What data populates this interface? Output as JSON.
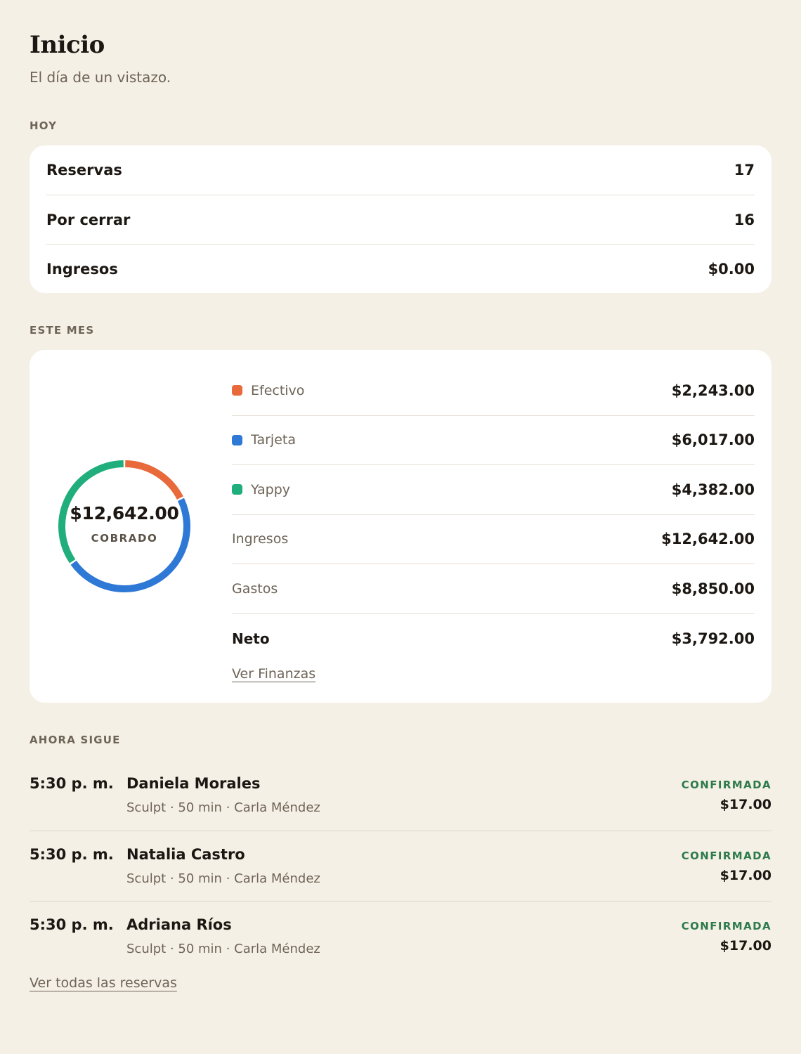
{
  "header": {
    "title": "Inicio",
    "subtitle": "El día de un vistazo."
  },
  "today": {
    "section_label": "HOY",
    "rows": [
      {
        "label": "Reservas",
        "value": "17"
      },
      {
        "label": "Por cerrar",
        "value": "16"
      },
      {
        "label": "Ingresos",
        "value": "$0.00"
      }
    ]
  },
  "month": {
    "section_label": "ESTE MES",
    "donut": {
      "total": "$12,642.00",
      "caption": "COBRADO"
    },
    "methods": [
      {
        "label": "Efectivo",
        "value": "$2,243.00",
        "color": "#e8693a"
      },
      {
        "label": "Tarjeta",
        "value": "$6,017.00",
        "color": "#2e78d6"
      },
      {
        "label": "Yappy",
        "value": "$4,382.00",
        "color": "#1fae7c"
      }
    ],
    "summary": [
      {
        "label": "Ingresos",
        "value": "$12,642.00"
      },
      {
        "label": "Gastos",
        "value": "$8,850.00"
      },
      {
        "label": "Neto",
        "value": "$3,792.00"
      }
    ],
    "link": "Ver Finanzas"
  },
  "chart_data": {
    "type": "pie",
    "title": "",
    "categories": [
      "Efectivo",
      "Tarjeta",
      "Yappy"
    ],
    "values": [
      2243,
      6017,
      4382
    ],
    "colors": [
      "#e8693a",
      "#2e78d6",
      "#1fae7c"
    ],
    "center_label": "$12,642.00",
    "center_caption": "COBRADO"
  },
  "next": {
    "section_label": "AHORA SIGUE",
    "appointments": [
      {
        "time": "5:30 p. m.",
        "name": "Daniela Morales",
        "service": "Sculpt",
        "duration": "50 min",
        "instructor": "Carla Méndez",
        "status": "CONFIRMADA",
        "price": "$17.00"
      },
      {
        "time": "5:30 p. m.",
        "name": "Natalia Castro",
        "service": "Sculpt",
        "duration": "50 min",
        "instructor": "Carla Méndez",
        "status": "CONFIRMADA",
        "price": "$17.00"
      },
      {
        "time": "5:30 p. m.",
        "name": "Adriana Ríos",
        "service": "Sculpt",
        "duration": "50 min",
        "instructor": "Carla Méndez",
        "status": "CONFIRMADA",
        "price": "$17.00"
      }
    ],
    "link": "Ver todas las reservas"
  }
}
